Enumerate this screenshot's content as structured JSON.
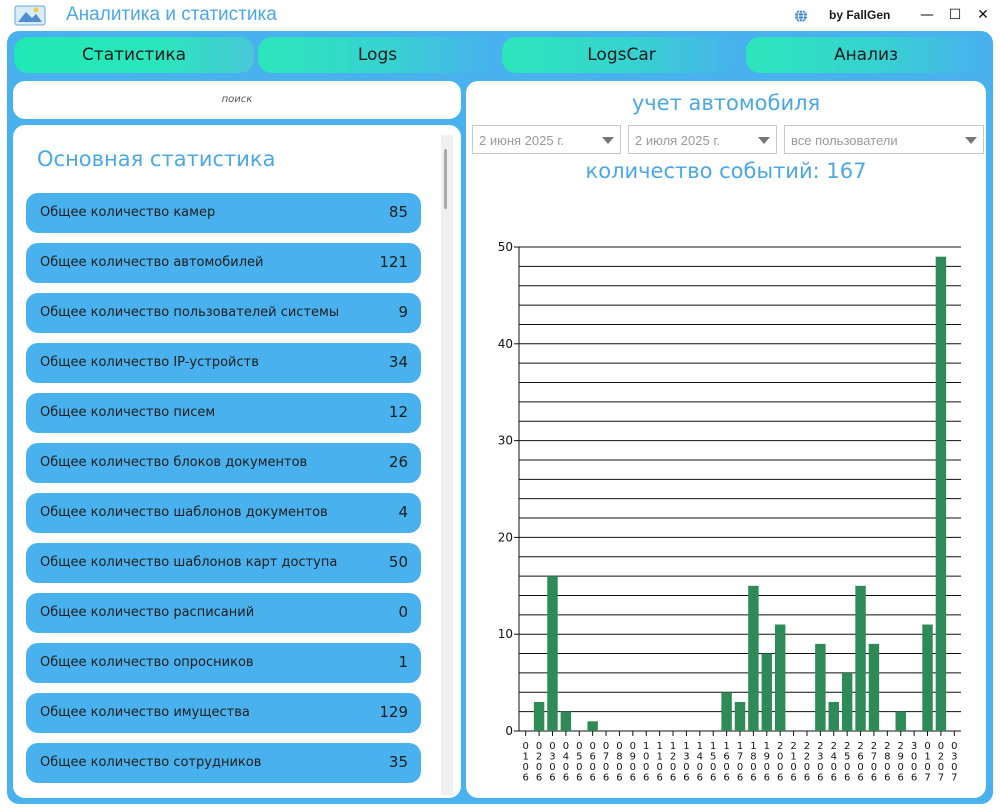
{
  "window": {
    "title": "Аналитика и статистика",
    "author": "by FallGen",
    "minimize_glyph": "—",
    "maximize_glyph": "☐",
    "close_glyph": "✕",
    "icons": {
      "app": "app-logo-icon",
      "globe": "globe-icon"
    }
  },
  "tabs": [
    {
      "label": "Статистика",
      "active": true
    },
    {
      "label": "Logs",
      "active": false
    },
    {
      "label": "LogsCar",
      "active": false
    },
    {
      "label": "Анализ",
      "active": false
    }
  ],
  "search": {
    "placeholder": "поиск"
  },
  "stats": {
    "title": "Основная статистика",
    "items": [
      {
        "label": "Общее количество камер",
        "value": "85"
      },
      {
        "label": "Общее количество автомобилей",
        "value": "121"
      },
      {
        "label": "Общее количество пользователей системы",
        "value": "9"
      },
      {
        "label": "Общее количество IP-устройств",
        "value": "34"
      },
      {
        "label": "Общее количество писем",
        "value": "12"
      },
      {
        "label": "Общее количество блоков документов",
        "value": "26"
      },
      {
        "label": "Общее количество шаблонов документов",
        "value": "4"
      },
      {
        "label": "Общее количество шаблонов карт доступа",
        "value": "50"
      },
      {
        "label": "Общее количество расписаний",
        "value": "0"
      },
      {
        "label": "Общее количество опросников",
        "value": "1"
      },
      {
        "label": "Общее количество имущества",
        "value": "129"
      },
      {
        "label": "Общее количество сотрудников",
        "value": "35"
      }
    ]
  },
  "car_panel": {
    "title": "учет автомобиля",
    "date_from": "2 июня 2025 г.",
    "date_to": "2 июля 2025 г.",
    "user_filter": "все пользователи",
    "count_label": "количество событий:",
    "count_value": "167"
  },
  "colors": {
    "accent": "#48b1ee",
    "title_text": "#4aa8e6",
    "tab_gradient_start": "#2ce6bb",
    "bar": "#2e8b57"
  },
  "chart_data": {
    "type": "bar",
    "categories": [
      [
        "0",
        "1",
        "0",
        "6"
      ],
      [
        "0",
        "2",
        "0",
        "6"
      ],
      [
        "0",
        "3",
        "0",
        "6"
      ],
      [
        "0",
        "4",
        "0",
        "6"
      ],
      [
        "0",
        "5",
        "0",
        "6"
      ],
      [
        "0",
        "6",
        "0",
        "6"
      ],
      [
        "0",
        "7",
        "0",
        "6"
      ],
      [
        "0",
        "8",
        "0",
        "6"
      ],
      [
        "0",
        "9",
        "0",
        "6"
      ],
      [
        "1",
        "0",
        "0",
        "6"
      ],
      [
        "1",
        "1",
        "0",
        "6"
      ],
      [
        "1",
        "2",
        "0",
        "6"
      ],
      [
        "1",
        "3",
        "0",
        "6"
      ],
      [
        "1",
        "4",
        "0",
        "6"
      ],
      [
        "1",
        "5",
        "0",
        "6"
      ],
      [
        "1",
        "6",
        "0",
        "6"
      ],
      [
        "1",
        "7",
        "0",
        "6"
      ],
      [
        "1",
        "8",
        "0",
        "6"
      ],
      [
        "1",
        "9",
        "0",
        "6"
      ],
      [
        "2",
        "0",
        "0",
        "6"
      ],
      [
        "2",
        "1",
        "0",
        "6"
      ],
      [
        "2",
        "2",
        "0",
        "6"
      ],
      [
        "2",
        "3",
        "0",
        "6"
      ],
      [
        "2",
        "4",
        "0",
        "6"
      ],
      [
        "2",
        "5",
        "0",
        "6"
      ],
      [
        "2",
        "6",
        "0",
        "6"
      ],
      [
        "2",
        "7",
        "0",
        "6"
      ],
      [
        "2",
        "8",
        "0",
        "6"
      ],
      [
        "2",
        "9",
        "0",
        "6"
      ],
      [
        "3",
        "0",
        "0",
        "6"
      ],
      [
        "0",
        "1",
        "0",
        "7"
      ],
      [
        "0",
        "2",
        "0",
        "7"
      ],
      [
        "0",
        "3",
        "0",
        "7"
      ]
    ],
    "values": [
      0,
      3,
      16,
      2,
      0,
      1,
      0,
      0,
      0,
      0,
      0,
      0,
      0,
      0,
      0,
      4,
      3,
      15,
      8,
      11,
      0,
      0,
      9,
      3,
      6,
      15,
      9,
      0,
      2,
      0,
      11,
      49,
      0
    ],
    "ylim": [
      0,
      50
    ],
    "yticks": [
      0,
      10,
      20,
      30,
      40,
      50
    ],
    "minor_step": 2,
    "grid": true
  }
}
